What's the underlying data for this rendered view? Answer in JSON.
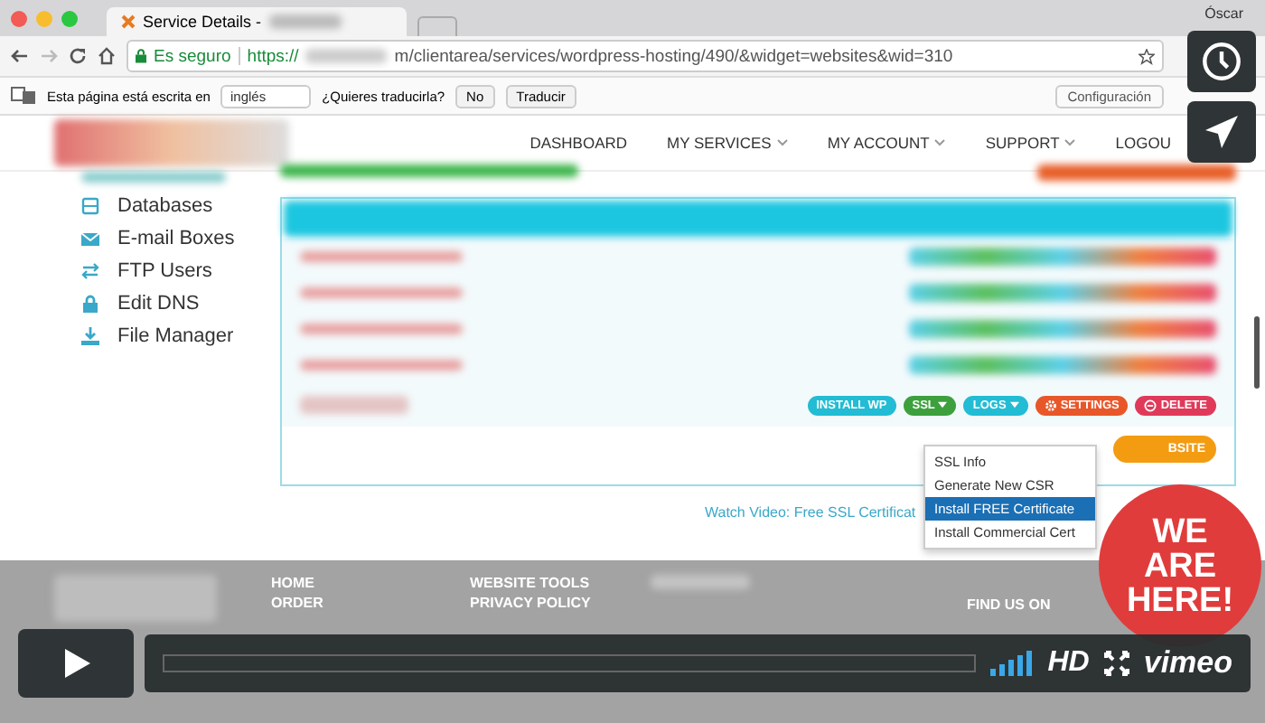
{
  "browser": {
    "tab_title": "Service Details - ",
    "user": "Óscar",
    "secure_label": "Es seguro",
    "url_start": "https://",
    "url_end": "m/clientarea/services/wordpress-hosting/490/&widget=websites&wid=310"
  },
  "translate_bar": {
    "prompt": "Esta página está escrita en",
    "language": "inglés",
    "question": "¿Quieres traducirla?",
    "buttons": [
      "No",
      "Traducir"
    ],
    "settings": "Configuración"
  },
  "nav": [
    {
      "label": "DASHBOARD",
      "dropdown": false
    },
    {
      "label": "MY SERVICES",
      "dropdown": true
    },
    {
      "label": "MY ACCOUNT",
      "dropdown": true
    },
    {
      "label": "SUPPORT",
      "dropdown": true
    },
    {
      "label": "LOGOU",
      "dropdown": false
    }
  ],
  "sidebar": [
    {
      "label": "Databases"
    },
    {
      "label": "E-mail Boxes"
    },
    {
      "label": "FTP Users"
    },
    {
      "label": "Edit DNS"
    },
    {
      "label": "File Manager"
    }
  ],
  "row_actions": [
    {
      "label": "INSTALL WP",
      "color": "#22bcd4",
      "caret": false
    },
    {
      "label": "SSL",
      "color": "#3da03d",
      "caret": true
    },
    {
      "label": "LOGS",
      "color": "#22bcd4",
      "caret": true
    },
    {
      "label": "SETTINGS",
      "color": "#e8572a",
      "caret": false
    },
    {
      "label": "DELETE",
      "color": "#e03a5a",
      "caret": false
    }
  ],
  "ssl_menu": [
    {
      "label": "SSL Info",
      "selected": false
    },
    {
      "label": "Generate New CSR",
      "selected": false
    },
    {
      "label": "Install FREE Certificate",
      "selected": true
    },
    {
      "label": "Install Commercial Cert",
      "selected": false
    }
  ],
  "add_button": "BSITE",
  "video_link": "Watch Video: Free SSL Certificat",
  "footer": {
    "col1": [
      "HOME",
      "ORDER"
    ],
    "col2": [
      "WEBSITE TOOLS",
      "PRIVACY POLICY"
    ],
    "find_us": "FIND US ON"
  },
  "sticker": [
    "WE",
    "ARE",
    "HERE!"
  ],
  "player": {
    "hd": "HD",
    "brand": "vimeo"
  }
}
